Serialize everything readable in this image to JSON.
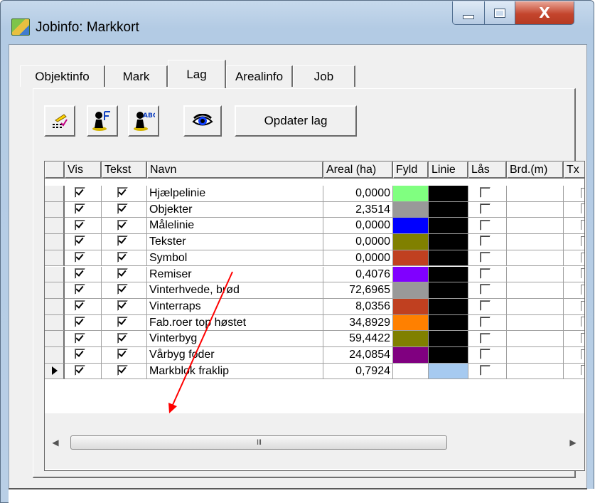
{
  "window": {
    "title": "Jobinfo: Markkort",
    "close_label": "X"
  },
  "tabs": [
    {
      "label": "Objektinfo"
    },
    {
      "label": "Mark"
    },
    {
      "label": "Lag"
    },
    {
      "label": "Arealinfo"
    },
    {
      "label": "Job"
    }
  ],
  "active_tab": "Lag",
  "toolbar": {
    "icons": [
      "layer-edit-icon",
      "layer-font-icon",
      "layer-text-icon",
      "visibility-eye-icon"
    ],
    "update_label": "Opdater lag"
  },
  "grid": {
    "columns": [
      "Vis",
      "Tekst",
      "Navn",
      "Areal (ha)",
      "Fyld",
      "Linie",
      "Lås",
      "Brd.(m)",
      "Tx"
    ],
    "rows": [
      {
        "vis": true,
        "tekst": true,
        "navn": "Hjælpelinie",
        "areal": "0,0000",
        "fyld": "#80ff80",
        "linie": "#000000",
        "laas": false
      },
      {
        "vis": true,
        "tekst": true,
        "navn": "Objekter",
        "areal": "2,3514",
        "fyld": "#999999",
        "linie": "#000000",
        "laas": false
      },
      {
        "vis": true,
        "tekst": true,
        "navn": "Målelinie",
        "areal": "0,0000",
        "fyld": "#0000ff",
        "linie": "#000000",
        "laas": false
      },
      {
        "vis": true,
        "tekst": true,
        "navn": "Tekster",
        "areal": "0,0000",
        "fyld": "#808000",
        "linie": "#000000",
        "laas": false
      },
      {
        "vis": true,
        "tekst": true,
        "navn": "Symbol",
        "areal": "0,0000",
        "fyld": "#c04020",
        "linie": "#000000",
        "laas": false
      },
      {
        "vis": true,
        "tekst": true,
        "navn": "Remiser",
        "areal": "0,4076",
        "fyld": "#8000ff",
        "linie": "#000000",
        "laas": false
      },
      {
        "vis": true,
        "tekst": true,
        "navn": "Vinterhvede, brød",
        "areal": "72,6965",
        "fyld": "#999999",
        "linie": "#000000",
        "laas": false
      },
      {
        "vis": true,
        "tekst": true,
        "navn": "Vinterraps",
        "areal": "8,0356",
        "fyld": "#c04020",
        "linie": "#000000",
        "laas": false
      },
      {
        "vis": true,
        "tekst": true,
        "navn": "Fab.roer top høstet",
        "areal": "34,8929",
        "fyld": "#ff8000",
        "linie": "#000000",
        "laas": false
      },
      {
        "vis": true,
        "tekst": true,
        "navn": "Vinterbyg",
        "areal": "59,4422",
        "fyld": "#808000",
        "linie": "#000000",
        "laas": false
      },
      {
        "vis": true,
        "tekst": true,
        "navn": "Vårbyg foder",
        "areal": "24,0854",
        "fyld": "#800080",
        "linie": "#000000",
        "laas": false
      },
      {
        "vis": true,
        "tekst": true,
        "navn": "Markblok fraklip",
        "areal": "0,7924",
        "fyld": "#ffffff",
        "linie": "#a6caf0",
        "laas": false,
        "current": true
      }
    ],
    "scroll_thumb_grip": "III"
  },
  "annotation": {
    "color": "#ff0000"
  }
}
